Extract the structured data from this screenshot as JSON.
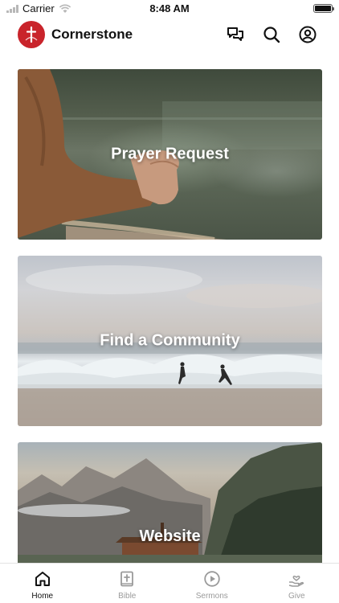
{
  "status_bar": {
    "carrier": "Carrier",
    "time": "8:48 AM",
    "battery_level": 1.0
  },
  "header": {
    "app_title": "Cornerstone",
    "logo_color": "#c9242b",
    "actions": [
      {
        "icon": "chat-icon"
      },
      {
        "icon": "search-icon"
      },
      {
        "icon": "profile-icon"
      }
    ]
  },
  "cards": [
    {
      "title": "Prayer Request"
    },
    {
      "title": "Find a Community"
    },
    {
      "title": "Website"
    }
  ],
  "tabbar": {
    "active": "Home",
    "tabs": [
      {
        "label": "Home",
        "icon": "home-icon"
      },
      {
        "label": "Bible",
        "icon": "bible-icon"
      },
      {
        "label": "Sermons",
        "icon": "play-circle-icon"
      },
      {
        "label": "Give",
        "icon": "give-hand-heart-icon"
      }
    ]
  },
  "colors": {
    "active_tab": "#111111",
    "inactive_tab": "#9a9a9a"
  }
}
